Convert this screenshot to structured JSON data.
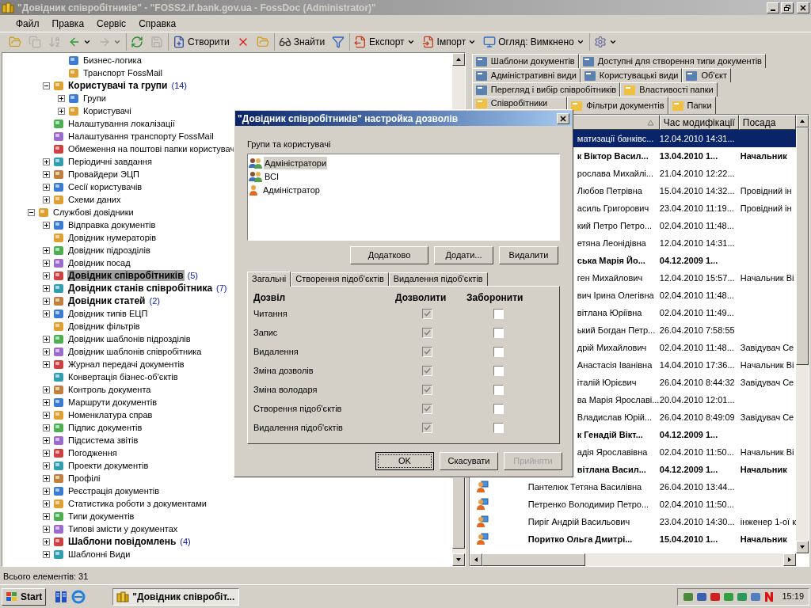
{
  "window": {
    "title": "\"Довідник співробітників\" - \"FOSS2.if.bank.gov.ua - FossDoc (Administrator)\""
  },
  "menu": [
    "Файл",
    "Правка",
    "Сервіс",
    "Справка"
  ],
  "toolbar": [
    {
      "kind": "icon",
      "disabled": false
    },
    {
      "kind": "icon",
      "disabled": true
    },
    {
      "kind": "icon",
      "disabled": true
    },
    {
      "kind": "split",
      "disabled": false
    },
    {
      "kind": "split",
      "disabled": true
    },
    {
      "kind": "icon",
      "disabled": false
    },
    {
      "kind": "icon",
      "disabled": true
    },
    {
      "kind": "button",
      "label": "Створити",
      "disabled": false
    },
    {
      "kind": "icon",
      "disabled": false
    },
    {
      "kind": "icon",
      "disabled": false
    },
    {
      "kind": "button",
      "label": "Знайти",
      "disabled": false
    },
    {
      "kind": "icon",
      "disabled": false
    },
    {
      "kind": "split",
      "label": "Експорт",
      "disabled": false
    },
    {
      "kind": "split",
      "label": "Імпорт",
      "disabled": false
    },
    {
      "kind": "split",
      "label": "Огляд: Вимкнено",
      "disabled": false
    },
    {
      "kind": "split",
      "disabled": false
    }
  ],
  "tree": [
    {
      "children": [
        {
          "children": [
            {
              "label": "Бизнес-логика",
              "kind": "leaf",
              "bold": false,
              "selected": false
            },
            {
              "label": "Транспорт FossMail",
              "kind": "leaf",
              "bold": false,
              "selected": false
            }
          ]
        },
        {
          "label": "Користувачі та групи",
          "count": "(14)",
          "kind": "branch",
          "expanded": true,
          "bold": true,
          "selected": false,
          "children": [
            {
              "label": "Групи",
              "kind": "branch",
              "expanded": false,
              "bold": false,
              "selected": false
            },
            {
              "label": "Користувачі",
              "kind": "branch",
              "expanded": false,
              "bold": false,
              "selected": false
            }
          ]
        },
        {
          "label": "Налаштування локалізації",
          "kind": "leaf",
          "bold": false,
          "selected": false
        },
        {
          "label": "Налаштування транспорту FossMail",
          "kind": "leaf",
          "bold": false,
          "selected": false
        },
        {
          "label": "Обмеження на поштові папки користувач",
          "kind": "leaf",
          "bold": false,
          "selected": false
        },
        {
          "label": "Періодичні завдання",
          "kind": "branch",
          "expanded": false,
          "bold": false,
          "selected": false
        },
        {
          "label": "Провайдери ЭЦП",
          "kind": "branch",
          "expanded": false,
          "bold": false,
          "selected": false
        },
        {
          "label": "Сесії користувачів",
          "kind": "branch",
          "expanded": false,
          "bold": false,
          "selected": false
        },
        {
          "label": "Схеми даних",
          "kind": "branch",
          "expanded": false,
          "bold": false,
          "selected": false
        }
      ]
    },
    {
      "label": "Службові довідники",
      "kind": "branch",
      "expanded": true,
      "bold": false,
      "selected": false,
      "children": [
        {
          "label": "Відправка документів",
          "kind": "branch",
          "expanded": false,
          "bold": false,
          "selected": false
        },
        {
          "label": "Довідник нумераторів",
          "kind": "leaf",
          "bold": false,
          "selected": false
        },
        {
          "label": "Довідник підрозділів",
          "kind": "branch",
          "expanded": false,
          "bold": false,
          "selected": false
        },
        {
          "label": "Довідник посад",
          "kind": "branch",
          "expanded": false,
          "bold": false,
          "selected": false
        },
        {
          "label": "Довідник співробітників",
          "count": "(5)",
          "kind": "branch",
          "expanded": false,
          "bold": true,
          "selected": true
        },
        {
          "label": "Довідник станів співробітника",
          "count": "(7)",
          "kind": "branch",
          "expanded": false,
          "bold": true,
          "selected": false
        },
        {
          "label": "Довідник статей",
          "count": "(2)",
          "kind": "branch",
          "expanded": false,
          "bold": true,
          "selected": false
        },
        {
          "label": "Довідник типів ЕЦП",
          "kind": "branch",
          "expanded": false,
          "bold": false,
          "selected": false
        },
        {
          "label": "Довідник фільтрів",
          "kind": "leaf",
          "bold": false,
          "selected": false
        },
        {
          "label": "Довідник шаблонів підрозділів",
          "kind": "branch",
          "expanded": false,
          "bold": false,
          "selected": false
        },
        {
          "label": "Довідник шаблонів співробітника",
          "kind": "branch",
          "expanded": false,
          "bold": false,
          "selected": false
        },
        {
          "label": "Журнал передачі документів",
          "kind": "branch",
          "expanded": false,
          "bold": false,
          "selected": false
        },
        {
          "label": "Конвертація бізнес-об'єктів",
          "kind": "leaf",
          "bold": false,
          "selected": false
        },
        {
          "label": "Контроль документа",
          "kind": "branch",
          "expanded": false,
          "bold": false,
          "selected": false
        },
        {
          "label": "Маршрути документів",
          "kind": "branch",
          "expanded": false,
          "bold": false,
          "selected": false
        },
        {
          "label": "Номенклатура справ",
          "kind": "branch",
          "expanded": false,
          "bold": false,
          "selected": false
        },
        {
          "label": "Підпис документів",
          "kind": "branch",
          "expanded": false,
          "bold": false,
          "selected": false
        },
        {
          "label": "Підсистема звітів",
          "kind": "branch",
          "expanded": false,
          "bold": false,
          "selected": false
        },
        {
          "label": "Погодження",
          "kind": "branch",
          "expanded": false,
          "bold": false,
          "selected": false
        },
        {
          "label": "Проекти документів",
          "kind": "branch",
          "expanded": false,
          "bold": false,
          "selected": false
        },
        {
          "label": "Профілі",
          "kind": "branch",
          "expanded": false,
          "bold": false,
          "selected": false
        },
        {
          "label": "Реєстрація документів",
          "kind": "branch",
          "expanded": false,
          "bold": false,
          "selected": false
        },
        {
          "label": "Статистика роботи з документами",
          "kind": "branch",
          "expanded": false,
          "bold": false,
          "selected": false
        },
        {
          "label": "Типи документів",
          "kind": "branch",
          "expanded": false,
          "bold": false,
          "selected": false
        },
        {
          "label": "Типові змісти у документах",
          "kind": "branch",
          "expanded": false,
          "bold": false,
          "selected": false
        },
        {
          "label": "Шаблони повідомлень",
          "count": "(4)",
          "kind": "branch",
          "expanded": false,
          "bold": true,
          "selected": false
        },
        {
          "label": "Шаблонні Види",
          "kind": "branch",
          "expanded": false,
          "bold": false,
          "selected": false
        }
      ]
    }
  ],
  "tab_rows": [
    [
      {
        "label": "Шаблони документів",
        "selected": false
      },
      {
        "label": "Доступні для створення типи документів",
        "selected": false
      }
    ],
    [
      {
        "label": "Адміністративні види",
        "selected": false
      },
      {
        "label": "Користувацькі види",
        "selected": false
      },
      {
        "label": "Об'єкт",
        "selected": false
      }
    ],
    [
      {
        "label": "Перегляд і вибір співробітників",
        "selected": false
      },
      {
        "label": "Властивості папки",
        "selected": false
      }
    ],
    [
      {
        "label": "Співробітники",
        "selected": true
      },
      {
        "label": "Фільтри документів",
        "selected": false
      },
      {
        "label": "Папки",
        "selected": false
      }
    ]
  ],
  "column_headers": [
    "Час модифікації",
    "Посада"
  ],
  "rows": [
    {
      "kind": "clipped",
      "name": "матизації банківс...",
      "modified": "12.04.2010 14:31...",
      "bold": false,
      "selected": true
    },
    {
      "kind": "clipped",
      "name": "к Віктор Васил...",
      "modified": "13.04.2010 1...",
      "position": "Начальник",
      "bold": true,
      "selected": false
    },
    {
      "kind": "clipped",
      "name": "рослава Михайлі...",
      "modified": "21.04.2010 12:22...",
      "bold": false,
      "selected": false
    },
    {
      "kind": "clipped",
      "name": "Любов Петрівна",
      "modified": "15.04.2010 14:32...",
      "position": "Провідний ін",
      "bold": false,
      "selected": false
    },
    {
      "kind": "clipped",
      "name": "асиль Григорович",
      "modified": "23.04.2010 11:19...",
      "position": "Провідний ін",
      "bold": false,
      "selected": false
    },
    {
      "kind": "clipped",
      "name": "кий Петро Петро...",
      "modified": "02.04.2010 11:48...",
      "bold": false,
      "selected": false
    },
    {
      "kind": "clipped",
      "name": "етяна Леонідівна",
      "modified": "12.04.2010 14:31...",
      "bold": false,
      "selected": false
    },
    {
      "kind": "clipped",
      "name": "ська Марія Йо...",
      "modified": "04.12.2009 1...",
      "bold": true,
      "selected": false
    },
    {
      "kind": "clipped",
      "name": "ген Михайлович",
      "modified": "12.04.2010 15:57...",
      "position": "Начальник Ві",
      "bold": false,
      "selected": false
    },
    {
      "kind": "clipped",
      "name": "вич Ірина Олегівна",
      "modified": "02.04.2010 11:48...",
      "bold": false,
      "selected": false
    },
    {
      "kind": "clipped",
      "name": "вітлана Юріївна",
      "modified": "02.04.2010 11:49...",
      "bold": false,
      "selected": false
    },
    {
      "kind": "clipped",
      "name": "ький Богдан Петр...",
      "modified": "26.04.2010 7:58:55",
      "bold": false,
      "selected": false
    },
    {
      "kind": "clipped",
      "name": "дрій Михайлович",
      "modified": "02.04.2010 11:48...",
      "position": "Завідувач Се",
      "bold": false,
      "selected": false
    },
    {
      "kind": "clipped",
      "name": "Анастасія Іванівна",
      "modified": "14.04.2010 17:36...",
      "position": "Начальник Ві",
      "bold": false,
      "selected": false
    },
    {
      "kind": "clipped",
      "name": "італій Юрієвич",
      "modified": "26.04.2010 8:44:32",
      "position": "Завідувач Се",
      "bold": false,
      "selected": false
    },
    {
      "kind": "clipped",
      "name": "ва Марія Ярославі...",
      "modified": "20.04.2010 12:01...",
      "bold": false,
      "selected": false
    },
    {
      "kind": "clipped",
      "name": "Владислав Юрій...",
      "modified": "26.04.2010 8:49:09",
      "position": "Завідувач Се",
      "bold": false,
      "selected": false
    },
    {
      "kind": "clipped",
      "name": "к Генадій Вікт...",
      "modified": "04.12.2009 1...",
      "bold": true,
      "selected": false
    },
    {
      "kind": "clipped",
      "name": "адія Ярославівна",
      "modified": "02.04.2010 11:50...",
      "position": "Начальник Ві",
      "bold": false,
      "selected": false
    },
    {
      "kind": "clipped",
      "name": "вітлана Васил...",
      "modified": "04.12.2009 1...",
      "position": "Начальник",
      "bold": true,
      "selected": false
    },
    {
      "kind": "full",
      "name": "Пантелюк Тетяна Василівна",
      "modified": "26.04.2010 13:44...",
      "bold": false,
      "selected": false
    },
    {
      "kind": "full",
      "name": "Петренко Володимир Петро...",
      "modified": "02.04.2010 11:50...",
      "bold": false,
      "selected": false
    },
    {
      "kind": "full",
      "name": "Пиріг Андрій Васильович",
      "modified": "23.04.2010 14:30...",
      "position": "інженер 1-ої к",
      "bold": false,
      "selected": false
    },
    {
      "kind": "full",
      "name": "Поритко Ольга Дмитрі...",
      "modified": "15.04.2010 1...",
      "position": "Начальник",
      "bold": true,
      "selected": false
    }
  ],
  "status_bar": "Всього елементів: 31",
  "dialog": {
    "title": "\"Довідник співробітників\" настройка дозволів",
    "list_label": "Групи та користувачі",
    "principals": [
      {
        "kind": "group",
        "label": "Адміністратори",
        "selected": true
      },
      {
        "kind": "group",
        "label": "ВСІ",
        "selected": false
      },
      {
        "kind": "user",
        "label": "Адміністратор",
        "selected": false
      }
    ],
    "list_buttons": [
      "Додатково",
      "Додати...",
      "Видалити"
    ],
    "tabs": [
      {
        "label": "Загальні",
        "selected": true
      },
      {
        "label": "Створення підоб'єктів",
        "selected": false
      },
      {
        "label": "Видалення підоб'єктів",
        "selected": false
      }
    ],
    "headers": [
      "Дозвіл",
      "Дозволити",
      "Заборонити"
    ],
    "permissions": [
      {
        "label": "Читання",
        "allow": true,
        "allow_disabled": true,
        "deny": false
      },
      {
        "label": "Запис",
        "allow": true,
        "allow_disabled": true,
        "deny": false
      },
      {
        "label": "Видалення",
        "allow": true,
        "allow_disabled": true,
        "deny": false
      },
      {
        "label": "Зміна дозволів",
        "allow": true,
        "allow_disabled": true,
        "deny": false
      },
      {
        "label": "Зміна володаря",
        "allow": true,
        "allow_disabled": true,
        "deny": false
      },
      {
        "label": "Створення підоб'єктів",
        "allow": true,
        "allow_disabled": true,
        "deny": false
      },
      {
        "label": "Видалення підоб'єктів",
        "allow": true,
        "allow_disabled": true,
        "deny": false
      }
    ],
    "buttons": [
      {
        "label": "OK",
        "disabled": false
      },
      {
        "label": "Скасувати",
        "disabled": false
      },
      {
        "label": "Прийняти",
        "disabled": true
      }
    ]
  },
  "taskbar": {
    "start": "Start",
    "task": "\"Довідник співробіт...",
    "clock": "15:19"
  }
}
